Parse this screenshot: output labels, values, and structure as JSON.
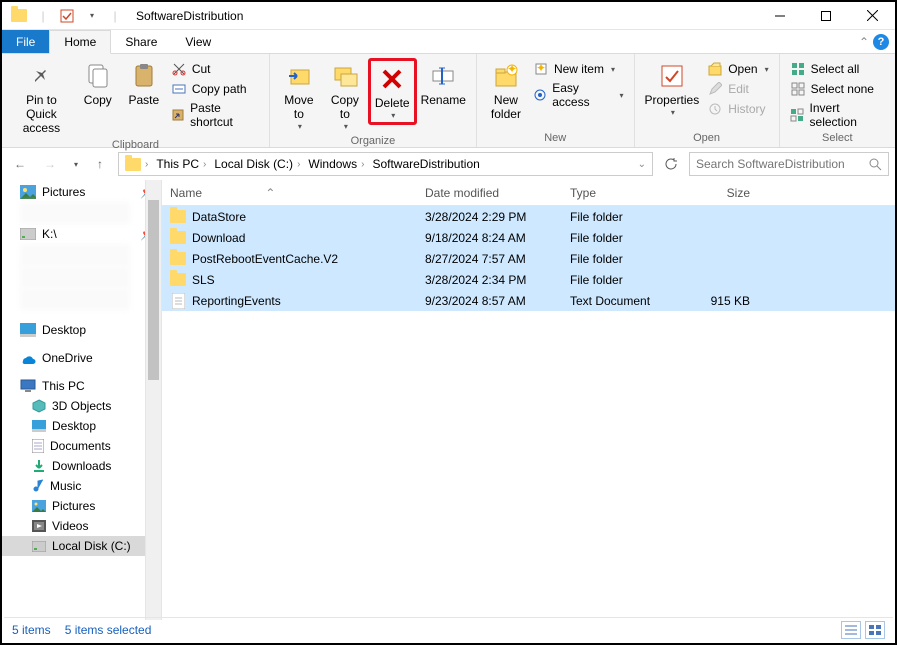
{
  "window": {
    "title": "SoftwareDistribution"
  },
  "tabs": {
    "file": "File",
    "home": "Home",
    "share": "Share",
    "view": "View"
  },
  "ribbon": {
    "clipboard": {
      "label": "Clipboard",
      "pin": "Pin to Quick\naccess",
      "copy": "Copy",
      "paste": "Paste",
      "cut": "Cut",
      "copy_path": "Copy path",
      "paste_shortcut": "Paste shortcut"
    },
    "organize": {
      "label": "Organize",
      "move_to": "Move\nto",
      "copy_to": "Copy\nto",
      "delete": "Delete",
      "rename": "Rename"
    },
    "new": {
      "label": "New",
      "new_folder": "New\nfolder",
      "new_item": "New item",
      "easy_access": "Easy access"
    },
    "open": {
      "label": "Open",
      "properties": "Properties",
      "open": "Open",
      "edit": "Edit",
      "history": "History"
    },
    "select": {
      "label": "Select",
      "select_all": "Select all",
      "select_none": "Select none",
      "invert": "Invert selection"
    }
  },
  "breadcrumb": {
    "c0": "This PC",
    "c1": "Local Disk (C:)",
    "c2": "Windows",
    "c3": "SoftwareDistribution"
  },
  "search": {
    "placeholder": "Search SoftwareDistribution"
  },
  "nav": {
    "pictures": "Pictures",
    "kdrive": "K:\\",
    "desktop": "Desktop",
    "onedrive": "OneDrive",
    "thispc": "This PC",
    "objects3d": "3D Objects",
    "desktop2": "Desktop",
    "documents": "Documents",
    "downloads": "Downloads",
    "music": "Music",
    "pictures2": "Pictures",
    "videos": "Videos",
    "localdisk": "Local Disk (C:)"
  },
  "columns": {
    "name": "Name",
    "date": "Date modified",
    "type": "Type",
    "size": "Size"
  },
  "rows": [
    {
      "name": "DataStore",
      "date": "3/28/2024 2:29 PM",
      "type": "File folder",
      "size": "",
      "icon": "folder"
    },
    {
      "name": "Download",
      "date": "9/18/2024 8:24 AM",
      "type": "File folder",
      "size": "",
      "icon": "folder"
    },
    {
      "name": "PostRebootEventCache.V2",
      "date": "8/27/2024 7:57 AM",
      "type": "File folder",
      "size": "",
      "icon": "folder"
    },
    {
      "name": "SLS",
      "date": "3/28/2024 2:34 PM",
      "type": "File folder",
      "size": "",
      "icon": "folder"
    },
    {
      "name": "ReportingEvents",
      "date": "9/23/2024 8:57 AM",
      "type": "Text Document",
      "size": "915 KB",
      "icon": "text"
    }
  ],
  "status": {
    "count": "5 items",
    "selected": "5 items selected"
  }
}
